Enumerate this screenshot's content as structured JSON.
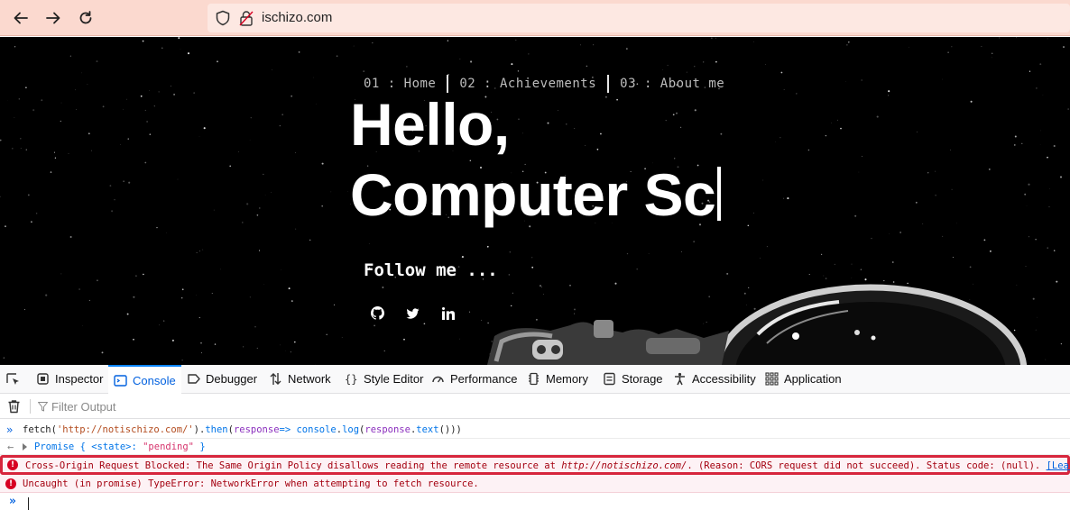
{
  "browser": {
    "url": "ischizo.com",
    "icons": [
      "back-arrow-icon",
      "forward-arrow-icon",
      "reload-icon",
      "shield-icon",
      "lock-icon"
    ]
  },
  "site": {
    "nav": [
      {
        "label": "01 : Home"
      },
      {
        "label": "02 : Achievements"
      },
      {
        "label": "03 : About me"
      }
    ],
    "hero_line1": "Hello,",
    "hero_line2": "Computer Sc",
    "follow": "Follow me ...",
    "social_icons": [
      "github-icon",
      "twitter-icon",
      "linkedin-icon"
    ]
  },
  "devtools": {
    "tabs": [
      {
        "label": "Inspector",
        "icon": "inspector-icon"
      },
      {
        "label": "Console",
        "icon": "console-icon",
        "active": true
      },
      {
        "label": "Debugger",
        "icon": "debugger-icon"
      },
      {
        "label": "Network",
        "icon": "network-icon"
      },
      {
        "label": "Style Editor",
        "icon": "style-editor-icon"
      },
      {
        "label": "Performance",
        "icon": "performance-icon"
      },
      {
        "label": "Memory",
        "icon": "memory-icon"
      },
      {
        "label": "Storage",
        "icon": "storage-icon"
      },
      {
        "label": "Accessibility",
        "icon": "accessibility-icon"
      },
      {
        "label": "Application",
        "icon": "application-icon"
      }
    ],
    "filter_placeholder": "Filter Output",
    "console": {
      "input": {
        "p1": "fetch(",
        "p2": "'http://notischizo.com/'",
        "p3": ").",
        "p4": "then",
        "p5": "(",
        "p6": "response",
        "p7": "=> ",
        "p8": "console",
        "p9": ".",
        "p10": "log",
        "p11": "(",
        "p12": "response",
        "p13": ".",
        "p14": "text",
        "p15": "()))"
      },
      "result": {
        "prefix": "Promise { <state>: ",
        "value": "\"pending\"",
        "suffix": " }"
      },
      "error1": {
        "text_a": "Cross-Origin Request Blocked: The Same Origin Policy disallows reading the remote resource at ",
        "url": "http://notischizo.com/",
        "text_b": ". (Reason: CORS request did not succeed). Status code: (null). ",
        "link": "[Learn More]"
      },
      "error2": "Uncaught (in promise) TypeError: NetworkError when attempting to fetch resource."
    }
  },
  "colors": {
    "toolbar": "#fbd9cf",
    "urlbar": "#fde8e2",
    "page_bg": "#000000",
    "accent": "#0a84ff",
    "error_text": "#a4000f",
    "error_highlight": "#d7263d"
  }
}
